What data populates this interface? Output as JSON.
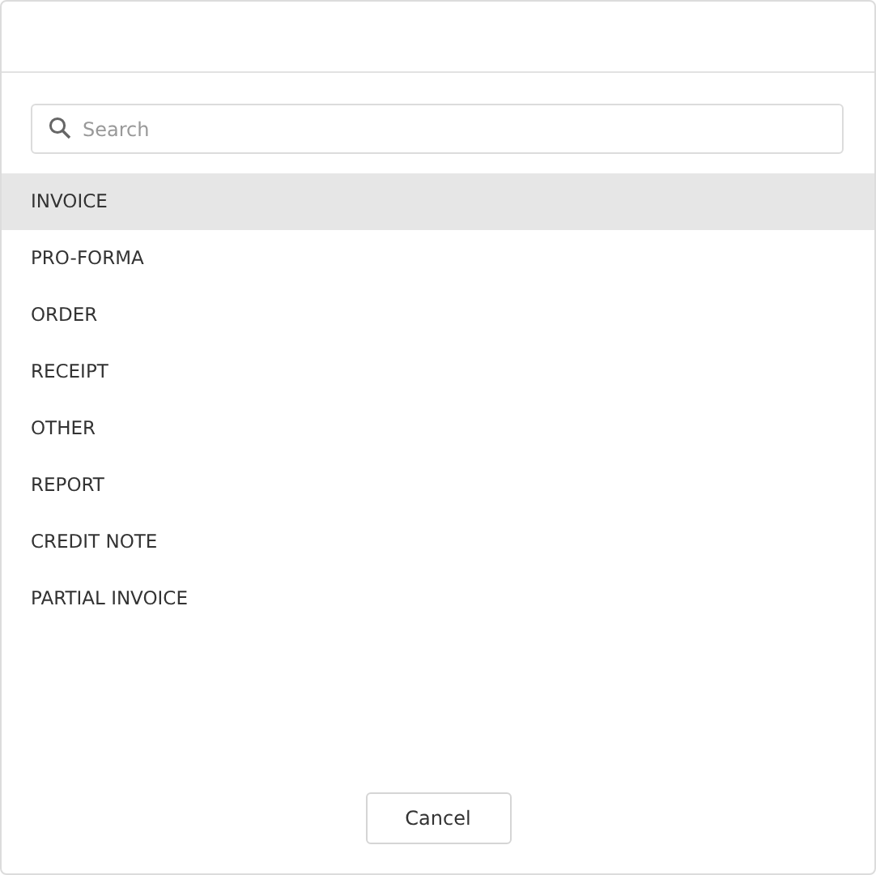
{
  "search": {
    "placeholder": "Search"
  },
  "items": [
    {
      "label": "INVOICE",
      "selected": true
    },
    {
      "label": "PRO-FORMA",
      "selected": false
    },
    {
      "label": "ORDER",
      "selected": false
    },
    {
      "label": "RECEIPT",
      "selected": false
    },
    {
      "label": "OTHER",
      "selected": false
    },
    {
      "label": "REPORT",
      "selected": false
    },
    {
      "label": "CREDIT NOTE",
      "selected": false
    },
    {
      "label": "PARTIAL INVOICE",
      "selected": false
    }
  ],
  "buttons": [
    "Cancel"
  ]
}
